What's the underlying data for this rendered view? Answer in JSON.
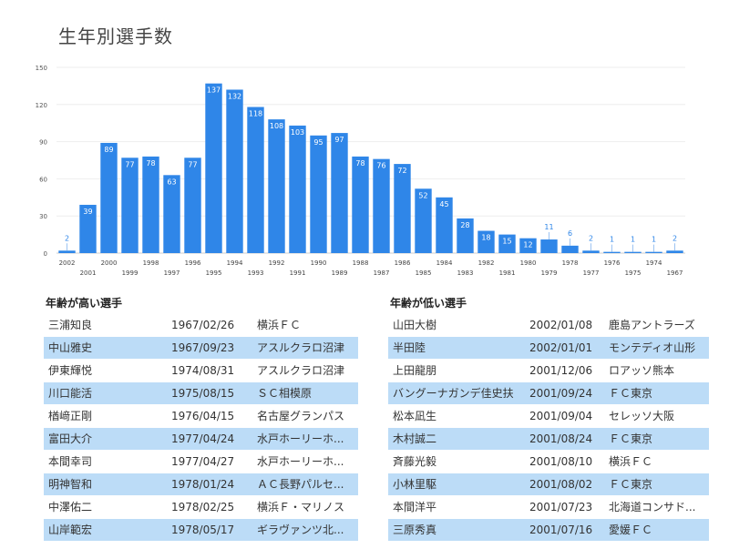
{
  "title": "生年別選手数",
  "chart_data": {
    "type": "bar",
    "color": "#2f86e8",
    "ylim": [
      0,
      150
    ],
    "yticks": [
      0,
      30,
      60,
      90,
      120,
      150
    ],
    "grid": true,
    "categories": [
      "2002",
      "2001",
      "2000",
      "1999",
      "1998",
      "1997",
      "1996",
      "1995",
      "1994",
      "1993",
      "1992",
      "1991",
      "1990",
      "1989",
      "1988",
      "1987",
      "1986",
      "1985",
      "1984",
      "1983",
      "1982",
      "1981",
      "1980",
      "1979",
      "1978",
      "1977",
      "1976",
      "1975",
      "1974",
      "1967"
    ],
    "values": [
      2,
      39,
      89,
      77,
      78,
      63,
      77,
      137,
      132,
      118,
      108,
      103,
      95,
      97,
      78,
      76,
      72,
      52,
      45,
      28,
      18,
      15,
      12,
      11,
      6,
      2,
      1,
      1,
      1,
      2
    ]
  },
  "tables": {
    "oldest": {
      "title": "年齢が高い選手",
      "rows": [
        {
          "name": "三浦知良",
          "date": "1967/02/26",
          "club": "横浜ＦＣ"
        },
        {
          "name": "中山雅史",
          "date": "1967/09/23",
          "club": "アスルクラロ沼津"
        },
        {
          "name": "伊東輝悦",
          "date": "1974/08/31",
          "club": "アスルクラロ沼津"
        },
        {
          "name": "川口能活",
          "date": "1975/08/15",
          "club": "ＳＣ相模原"
        },
        {
          "name": "楢﨑正剛",
          "date": "1976/04/15",
          "club": "名古屋グランパス"
        },
        {
          "name": "富田大介",
          "date": "1977/04/24",
          "club": "水戸ホーリーホ..."
        },
        {
          "name": "本間幸司",
          "date": "1977/04/27",
          "club": "水戸ホーリーホ..."
        },
        {
          "name": "明神智和",
          "date": "1978/01/24",
          "club": "ＡＣ長野パルセ..."
        },
        {
          "name": "中澤佑二",
          "date": "1978/02/25",
          "club": "横浜Ｆ・マリノス"
        },
        {
          "name": "山岸範宏",
          "date": "1978/05/17",
          "club": "ギラヴァンツ北..."
        }
      ]
    },
    "youngest": {
      "title": "年齢が低い選手",
      "rows": [
        {
          "name": "山田大樹",
          "date": "2002/01/08",
          "club": "鹿島アントラーズ"
        },
        {
          "name": "半田陸",
          "date": "2002/01/01",
          "club": "モンテディオ山形"
        },
        {
          "name": "上田龍朋",
          "date": "2001/12/06",
          "club": "ロアッソ熊本"
        },
        {
          "name": "バングーナガンデ佳史扶",
          "date": "2001/09/24",
          "club": "ＦＣ東京"
        },
        {
          "name": "松本凪生",
          "date": "2001/09/04",
          "club": "セレッソ大阪"
        },
        {
          "name": "木村誠二",
          "date": "2001/08/24",
          "club": "ＦＣ東京"
        },
        {
          "name": "斉藤光毅",
          "date": "2001/08/10",
          "club": "横浜ＦＣ"
        },
        {
          "name": "小林里駆",
          "date": "2001/08/02",
          "club": "ＦＣ東京"
        },
        {
          "name": "本間洋平",
          "date": "2001/07/23",
          "club": "北海道コンサド..."
        },
        {
          "name": "三原秀真",
          "date": "2001/07/16",
          "club": "愛媛ＦＣ"
        }
      ]
    }
  }
}
